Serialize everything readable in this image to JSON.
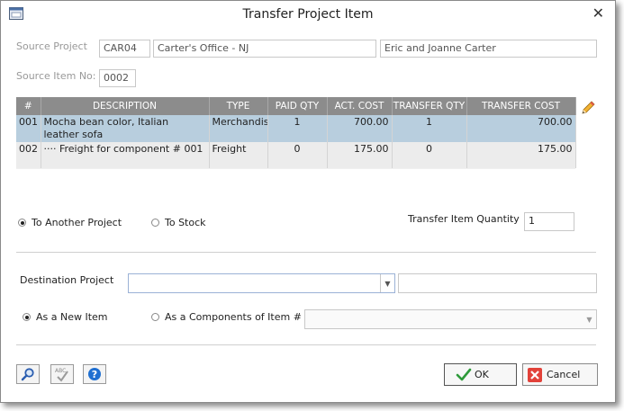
{
  "window": {
    "title": "Transfer Project Item"
  },
  "source": {
    "project_label": "Source Project",
    "project_code": "CAR04",
    "project_name": "Carter's Office - NJ",
    "customer": "Eric and Joanne Carter",
    "item_label": "Source Item No:",
    "item_no": "0002"
  },
  "grid": {
    "columns": [
      "#",
      "DESCRIPTION",
      "TYPE",
      "PAID QTY",
      "ACT. COST",
      "TRANSFER QTY",
      "TRANSFER COST"
    ],
    "rows": [
      {
        "num": "001",
        "desc_line1": "Mocha bean color, Italian",
        "desc_line2": "leather sofa",
        "type": "Merchandis",
        "paid_qty": "1",
        "act_cost": "700.00",
        "transfer_qty": "1",
        "transfer_cost": "700.00"
      },
      {
        "num": "002",
        "desc_line1": "···· Freight for component # 001",
        "type": "Freight",
        "paid_qty": "0",
        "act_cost": "175.00",
        "transfer_qty": "0",
        "transfer_cost": "175.00"
      }
    ]
  },
  "transfer": {
    "to_another_project": "To Another Project",
    "to_stock": "To Stock",
    "qty_label": "Transfer Item Quantity",
    "qty_value": "1"
  },
  "destination": {
    "project_label": "Destination Project",
    "project_value": "",
    "project_name": "",
    "as_new_item": "As a New Item",
    "as_component": "As a Components of Item #",
    "component_value": ""
  },
  "footer": {
    "ok_label": "OK",
    "cancel_label": "Cancel"
  },
  "icons": [
    "window-icon",
    "close-icon",
    "pencil-icon",
    "search-icon",
    "spellcheck-icon",
    "help-icon",
    "check-icon",
    "cancel-x-icon"
  ]
}
